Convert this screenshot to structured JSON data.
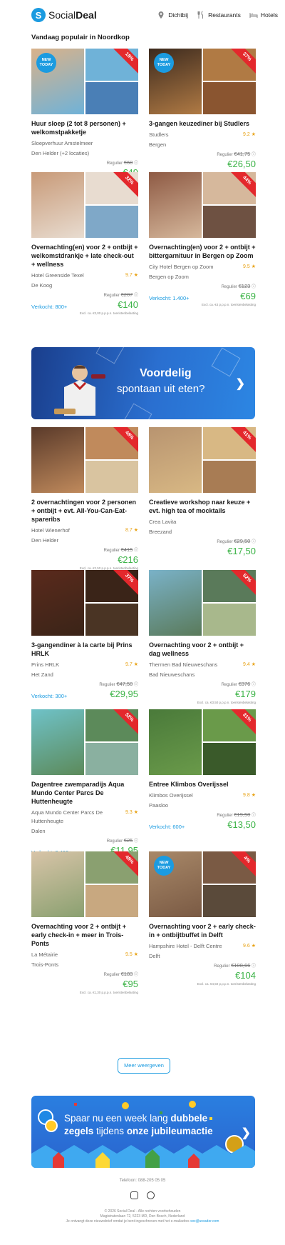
{
  "header": {
    "logo_mark": "S",
    "logo_text_1": "Social",
    "logo_text_2": "Deal",
    "nav": [
      {
        "label": "Dichtbij",
        "icon": "location-pin-icon"
      },
      {
        "label": "Restaurants",
        "icon": "cutlery-icon"
      },
      {
        "label": "Hotels",
        "icon": "bed-icon"
      }
    ]
  },
  "section_title": "Vandaag populair in Noordkop",
  "deals": [
    {
      "title": "Huur sloep (2 tot 8 personen) + welkomstpakketje",
      "merchant": "Sloepverhuur Amstelmeer",
      "location": "Den Helder (+2 locaties)",
      "rating": "",
      "sold": "",
      "regular_label": "Regulier",
      "regular": "€60",
      "price": "€49",
      "discount": "18%",
      "new": "NEW TODAY",
      "note": "",
      "colors": [
        "#d9b28a",
        "#6fb2d8",
        "#4a7fb6"
      ]
    },
    {
      "title": "3-gangen keuzediner bij Studlers",
      "merchant": "Studlers",
      "location": "Bergen",
      "rating": "9.2",
      "sold": "",
      "regular_label": "Regulier",
      "regular": "€41,75",
      "price": "€26,50",
      "discount": "37%",
      "new": "NEW TODAY",
      "note": "",
      "colors": [
        "#3c2a1e",
        "#b07a44",
        "#8a5530"
      ]
    },
    {
      "title": "Overnachting(en) voor 2 + ontbijt + welkomstdrankje + late check-out + wellness",
      "merchant": "Hotel Greenside Texel",
      "location": "De Koog",
      "rating": "9.7",
      "sold": "Verkocht: 800+",
      "regular_label": "Regulier",
      "regular": "€207",
      "price": "€140",
      "discount": "32%",
      "new": "",
      "note": "Excl. ca. €3,00 p.p.p.n. toeristenbelasting",
      "colors": [
        "#c89a78",
        "#e8dcd0",
        "#7fa8c8"
      ]
    },
    {
      "title": "Overnachting(en) voor 2 + ontbijt + bittergarnituur in Bergen op Zoom",
      "merchant": "City Hotel Bergen op Zoom",
      "location": "Bergen op Zoom",
      "rating": "9.5",
      "sold": "Verkocht: 1.400+",
      "regular_label": "Regulier",
      "regular": "€123",
      "price": "€69",
      "discount": "44%",
      "new": "",
      "note": "Excl. ca. €4 p.p.p.n. toeristenbelasting",
      "colors": [
        "#8e5a44",
        "#d6b89c",
        "#6e5142"
      ]
    },
    {
      "title": "2 overnachtingen voor 2 personen + ontbijt + evt. All-You-Can-Eat-spareribs",
      "merchant": "Hotel Wienerhof",
      "location": "Den Helder",
      "rating": "8.7",
      "sold": "",
      "regular_label": "Regulier",
      "regular": "€415",
      "price": "€216",
      "discount": "48%",
      "new": "",
      "note": "Excl. ca. €2,50 p.p.p.n. toeristenbelasting",
      "colors": [
        "#5a3a2a",
        "#c08a5c",
        "#d9c4a0"
      ]
    },
    {
      "title": "Creatieve workshop naar keuze + evt. high tea of mocktails",
      "merchant": "Crea Lavita",
      "location": "Breezand",
      "rating": "",
      "sold": "",
      "regular_label": "Regulier",
      "regular": "€29,50",
      "price": "€17,50",
      "discount": "41%",
      "new": "",
      "note": "",
      "colors": [
        "#b89470",
        "#d8b884",
        "#a87c54"
      ]
    },
    {
      "title": "3-gangendiner à la carte bij Prins HRLK",
      "merchant": "Prins HRLK",
      "location": "Het Zand",
      "rating": "9.7",
      "sold": "Verkocht: 300+",
      "regular_label": "Regulier",
      "regular": "€47,50",
      "price": "€29,95",
      "discount": "37%",
      "new": "",
      "note": "",
      "colors": [
        "#5a2a1c",
        "#3a2418",
        "#4a3424"
      ]
    },
    {
      "title": "Overnachting voor 2 + ontbijt + dag wellness",
      "merchant": "Thermen Bad Nieuweschans",
      "location": "Bad Nieuweschans",
      "rating": "9.4",
      "sold": "",
      "regular_label": "Regulier",
      "regular": "€376",
      "price": "€179",
      "discount": "52%",
      "new": "",
      "note": "Excl. ca. €3,50 p.p.p.n. toeristenbelasting",
      "colors": [
        "#7ab2c8",
        "#5a7a5a",
        "#a8b88c"
      ]
    },
    {
      "title": "Dagentree zwemparadijs Aqua Mundo Center Parcs De Huttenheugte",
      "merchant": "Aqua Mundo Center Parcs De Huttenheugte",
      "location": "Dalen",
      "rating": "9.3",
      "sold": "Verkocht: 2.400+",
      "regular_label": "Regulier",
      "regular": "€25",
      "price": "€11,95",
      "discount": "52%",
      "new": "",
      "note": "",
      "colors": [
        "#6fc2c8",
        "#5c8a5a",
        "#8ab0a0"
      ]
    },
    {
      "title": "Entree Klimbos Overijssel",
      "merchant": "Klimbos Overijssel",
      "location": "Paasloo",
      "rating": "9.8",
      "sold": "Verkocht: 600+",
      "regular_label": "Regulier",
      "regular": "€19,50",
      "price": "€13,50",
      "discount": "31%",
      "new": "",
      "note": "",
      "colors": [
        "#4a7a3a",
        "#6a9a4a",
        "#3a5a2a"
      ]
    },
    {
      "title": "Overnachting voor 2 + ontbijt + early check-in + meer in Trois-Ponts",
      "merchant": "La Métairie",
      "location": "Trois-Ponts",
      "rating": "9.5",
      "sold": "",
      "regular_label": "Regulier",
      "regular": "€183",
      "price": "€95",
      "discount": "48%",
      "new": "",
      "note": "Excl. ca. €1,30 p.p.p.n. toeristenbelasting",
      "colors": [
        "#d8c4a8",
        "#8aa070",
        "#c8a880"
      ]
    },
    {
      "title": "Overnachting voor 2 + early check-in + ontbijtbuffet in Delft",
      "merchant": "Hampshire Hotel - Delft Centre",
      "location": "Delft",
      "rating": "9.6",
      "sold": "",
      "regular_label": "Regulier",
      "regular": "€108,66",
      "price": "€104",
      "discount": "4%",
      "new": "NEW TODAY",
      "note": "Excl. ca. €4,50 p.p.p.n. toeristenbelasting",
      "colors": [
        "#a88868",
        "#7a5a44",
        "#5a4a3a"
      ]
    }
  ],
  "banner_1": {
    "line1": "Voordelig",
    "line2": "spontaan uit eten?"
  },
  "more_button": "Meer weergeven",
  "banner_2": {
    "t1_pre": "Spaar nu een week lang ",
    "t1_bold": "dubbele",
    "t2_bold1": "zegels",
    "t2_mid": " tijdens ",
    "t2_bold2": "onze jubileumactie"
  },
  "footer": {
    "phone": "Telefoon: 088-205 05 05",
    "legal1": "© 2026 Social Deal - Alle rechten voorbehouden",
    "legal2": "Magistratenlaan 72, 5223 MD, Den Bosch, Nederland",
    "legal3": "Je ontvangt deze nieuwsbrief omdat je bent ingeschreven met het e-mailadres",
    "email": "xxx@ureader.com"
  },
  "colors": {
    "accent": "#1b9be0",
    "price": "#3bb346",
    "ribbon": "#e3282c",
    "rating": "#e8a317"
  }
}
